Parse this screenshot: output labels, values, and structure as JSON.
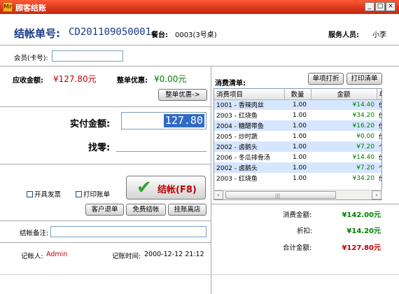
{
  "window": {
    "title": "顾客结账",
    "app_icon": "Mr"
  },
  "header": {
    "order_label": "结帐单号:",
    "order_no": "CD201109050001",
    "table_label": "餐台:",
    "table_value": "0003(3号桌)",
    "staff_label": "服务人员:",
    "staff_value": "小李"
  },
  "member": {
    "label": "会员(卡号):",
    "value": ""
  },
  "amounts": {
    "receivable_label": "应收金额:",
    "receivable_value": "¥127.80元",
    "discount_label": "整单优惠:",
    "discount_value": "¥0.00元",
    "discount_button": "整单优惠->"
  },
  "payment": {
    "paid_label": "实付金额:",
    "paid_value": "127.80",
    "change_label": "找零:",
    "change_value": ""
  },
  "options": {
    "invoice_label": "开具发票",
    "print_label": "打印账单"
  },
  "actions": {
    "settle_label": "结帐(F8)",
    "return_label": "客户退单",
    "free_label": "免费结帐",
    "hang_label": "挂账离店"
  },
  "note": {
    "label": "结帐备注:",
    "value": ""
  },
  "footer": {
    "recorder_label": "记帐人:",
    "recorder_value": "Admin",
    "time_label": "记账时间:",
    "time_value": "2000-12-12 21:12"
  },
  "consumption": {
    "title": "消费清单:",
    "print_item_button": "单项打折",
    "print_list_button": "打印清单",
    "columns": [
      "消费项目",
      "数量",
      "金额",
      "单"
    ],
    "rows": [
      {
        "item": "1001 - 香辣肉丝",
        "qty": "1.00",
        "amount": "¥14.40",
        "unit": "份"
      },
      {
        "item": "2003 - 红烧鱼",
        "qty": "1.00",
        "amount": "¥34.20",
        "unit": "份"
      },
      {
        "item": "2004 - 糖醋带鱼",
        "qty": "1.00",
        "amount": "¥16.20",
        "unit": "份"
      },
      {
        "item": "2005 - 炒时蔬",
        "qty": "1.00",
        "amount": "¥0.00",
        "unit": "份"
      },
      {
        "item": "2002 - 卤鹅头",
        "qty": "1.00",
        "amount": "¥7.20",
        "unit": "个"
      },
      {
        "item": "2006 - 冬瓜排骨汤",
        "qty": "1.00",
        "amount": "¥14.40",
        "unit": "份"
      },
      {
        "item": "2002 - 卤鹅头",
        "qty": "1.00",
        "amount": "¥7.20",
        "unit": "个"
      },
      {
        "item": "2003 - 红烧鱼",
        "qty": "1.00",
        "amount": "¥34.20",
        "unit": "份"
      }
    ]
  },
  "summary": {
    "consume_label": "消费金额:",
    "consume_value": "¥142.00元",
    "discount_label": "折扣:",
    "discount_value": "¥14.20元",
    "total_label": "合计金额:",
    "total_value": "¥127.80元"
  },
  "colors": {
    "titlebar": "#d8361c",
    "header_blue": "#183a8c",
    "money_red": "#c00000",
    "money_green": "#008000"
  },
  "icons": {
    "app": "app-icon",
    "minimize": "minimize-icon",
    "maximize": "maximize-icon",
    "close": "close-icon",
    "settle": "check-icon"
  }
}
